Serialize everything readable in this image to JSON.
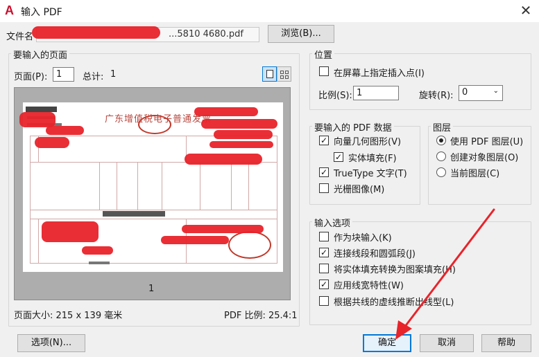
{
  "window": {
    "title": "输入 PDF",
    "icon": "A",
    "close": "✕"
  },
  "file": {
    "label": "文件名",
    "value": "...5810 4680.pdf",
    "browse": "浏览(B)..."
  },
  "pages": {
    "group_label": "要输入的页面",
    "page_label": "页面(P):",
    "page_value": "1",
    "total_label": "总计:",
    "total_value": "1",
    "preview_page_number": "1",
    "page_size": "页面大小: 215 x 139 毫米",
    "pdf_scale": "PDF 比例: 25.4:1",
    "invoice_title": "广东增值税电子普通发票"
  },
  "position": {
    "group_label": "位置",
    "specify_on_screen": "在屏幕上指定插入点(I)",
    "specify_checked": false,
    "scale_label": "比例(S):",
    "scale_value": "1",
    "rotate_label": "旋转(R):",
    "rotate_value": "0"
  },
  "pdf_data": {
    "group_label": "要输入的 PDF 数据",
    "items": [
      {
        "label": "向量几何图形(V)",
        "checked": true
      },
      {
        "label": "实体填充(F)",
        "checked": true
      },
      {
        "label": "TrueType 文字(T)",
        "checked": true
      },
      {
        "label": "光栅图像(M)",
        "checked": false
      }
    ]
  },
  "layers": {
    "group_label": "图层",
    "options": [
      {
        "label": "使用 PDF 图层(U)",
        "selected": true
      },
      {
        "label": "创建对象图层(O)",
        "selected": false
      },
      {
        "label": "当前图层(C)",
        "selected": false
      }
    ]
  },
  "import_options": {
    "group_label": "输入选项",
    "items": [
      {
        "label": "作为块输入(K)",
        "checked": false
      },
      {
        "label": "连接线段和圆弧段(J)",
        "checked": true
      },
      {
        "label": "将实体填充转换为图案填充(H)",
        "checked": false
      },
      {
        "label": "应用线宽特性(W)",
        "checked": true
      },
      {
        "label": "根据共线的虚线推断出线型(L)",
        "checked": false
      }
    ]
  },
  "buttons": {
    "options": "选项(N)...",
    "ok": "确定",
    "cancel": "取消",
    "help": "帮助"
  },
  "colors": {
    "accent": "#0078d7",
    "annotation_red": "#e8232a",
    "invoice_red": "#c0392b"
  }
}
